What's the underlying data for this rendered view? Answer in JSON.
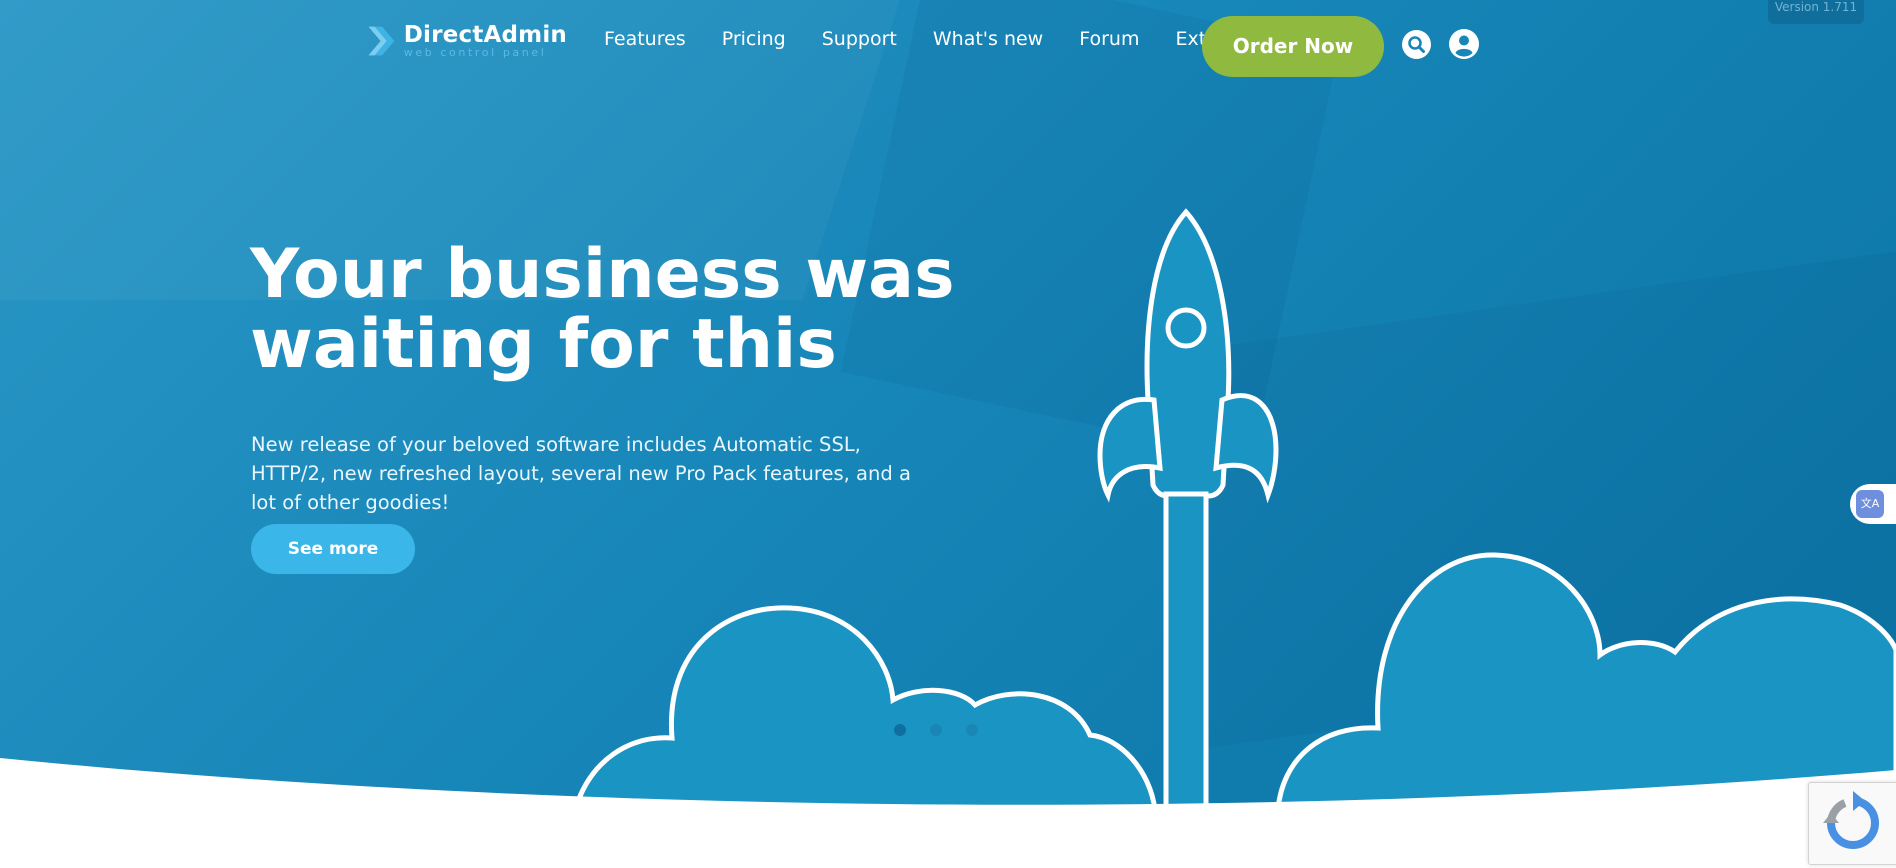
{
  "brand": {
    "name": "DirectAdmin",
    "tagline": "web control panel",
    "version": "Version 1.711"
  },
  "nav": {
    "items": [
      "Features",
      "Pricing",
      "Support",
      "What's new",
      "Forum",
      "Extras"
    ],
    "order_button": "Order Now"
  },
  "hero": {
    "headline_line1": "Your business was",
    "headline_line2": "waiting for this",
    "description": "New release of your beloved software includes Automatic SSL, HTTP/2, new refreshed layout, several new Pro Pack features, and a lot of other goodies!",
    "cta": "See more"
  },
  "slider": {
    "slide_count": 3,
    "active_index": 0
  },
  "colors": {
    "hero_bg": "#1786b8",
    "order_button": "#8fba3f",
    "cta_button": "#3bb6e8",
    "cloud_fill": "#1a94c2"
  },
  "icons": {
    "logo": "directadmin-logo-icon",
    "search": "search-icon",
    "user": "user-icon",
    "translate": "translate-icon",
    "recaptcha": "recaptcha-icon"
  }
}
